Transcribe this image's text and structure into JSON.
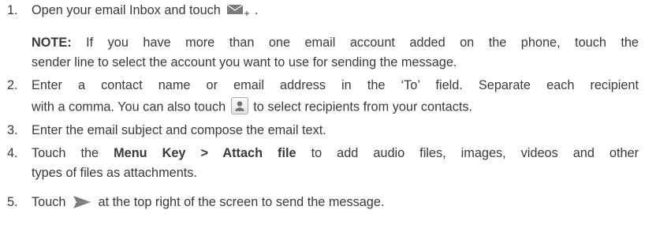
{
  "steps": [
    {
      "num": "1.",
      "text_before": "Open your email Inbox and touch",
      "text_after": " ."
    },
    {
      "note_label": "NOTE:",
      "note_line1": " If you have more than one email account added on the phone, touch the",
      "note_line2": "sender line to select the account you want to use for sending the message."
    },
    {
      "num": "2.",
      "line1": "Enter a contact name or email address in the ‘To’ field. Separate each recipient",
      "line2_before": "with a comma. You can also touch",
      "line2_after": " to select recipients from your contacts."
    },
    {
      "num": "3.",
      "text": "Enter the email subject and compose the email text."
    },
    {
      "num": "4.",
      "line1_before": "Touch the ",
      "line1_bold": "Menu Key > Attach file",
      "line1_after": " to add audio files, images, videos and other",
      "line2": "types of files as attachments."
    },
    {
      "num": "5.",
      "text_before": "Touch",
      "text_after": " at the top right of the screen to send the message."
    }
  ],
  "icons": {
    "compose": "compose-email-icon",
    "contact": "contact-picker-icon",
    "send": "send-icon"
  },
  "colors": {
    "text": "#3a3a3a",
    "icon": "#7a7a7a"
  }
}
